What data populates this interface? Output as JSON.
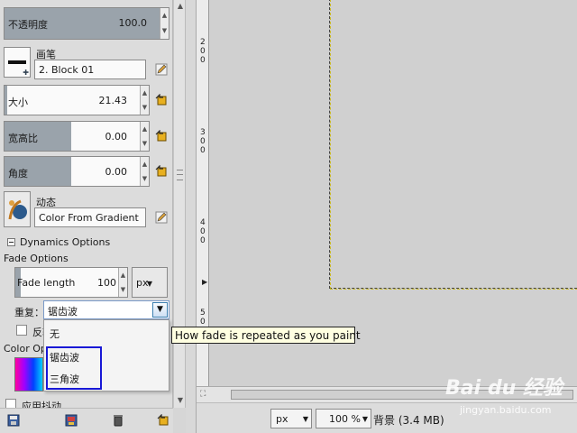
{
  "tool_options": {
    "opacity": {
      "label": "不透明度",
      "value": "100.0",
      "fill": 1.0
    },
    "brush": {
      "label": "画笔",
      "value": "2. Block 01"
    },
    "size": {
      "label": "大小",
      "value": "21.43",
      "fill": 0.02
    },
    "aspect_ratio": {
      "label": "宽高比",
      "value": "0.00",
      "fill": 0.5
    },
    "angle": {
      "label": "角度",
      "value": "0.00",
      "fill": 0.5
    },
    "dynamics": {
      "label": "动态",
      "value": "Color From Gradient"
    },
    "dynamics_options_label": "Dynamics Options",
    "fade_options_label": "Fade Options",
    "fade_length": {
      "label": "Fade length",
      "value": "100",
      "fill": 0.05
    },
    "fade_unit": "px",
    "repeat": {
      "label": "重复：",
      "selected": "锯齿波",
      "options": [
        "无",
        "锯齿波",
        "三角波"
      ]
    },
    "reverse_label": "反转",
    "color_options_label": "Color Options",
    "apply_jitter_label": "应用抖动"
  },
  "tooltip": "How fade is repeated as you paint",
  "ruler_marks": [
    "2\n0\n0",
    "3\n0\n0",
    "4\n0\n0",
    "5\n0\n0"
  ],
  "status_bar": {
    "unit": "px",
    "zoom": "100 %",
    "info": "背景 (3.4 MB)"
  },
  "watermark": {
    "logo": "Bai du 经验",
    "url": "jingyan.baidu.com"
  },
  "colors": {
    "slider_fill": "#9aa3ab",
    "highlight_box": "#1818d6",
    "tooltip_bg": "#ffffe1",
    "canvas_bg": "#d0d0d0"
  }
}
